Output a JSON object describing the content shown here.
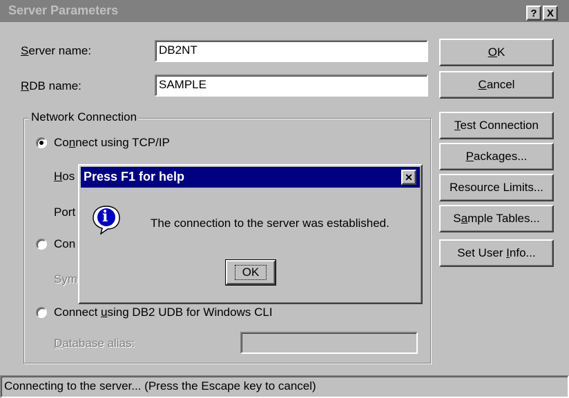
{
  "window": {
    "title": "Server Parameters",
    "help_glyph": "?",
    "close_glyph": "X",
    "title_bg": "#808080"
  },
  "form": {
    "server_name_label_u": "S",
    "server_name_label_rest": "erver name:",
    "server_name_value": "DB2NT",
    "rdb_name_label_u": "R",
    "rdb_name_label_rest": "DB name:",
    "rdb_name_value": "SAMPLE"
  },
  "network": {
    "group_label": "Network Connection",
    "tcp": {
      "pre": "Co",
      "u": "n",
      "post": "nect using TCP/IP",
      "checked": true
    },
    "host_label_u": "H",
    "host_label_rest": "os",
    "port_label": "Port",
    "conn_label": "Con",
    "sym_label": "Sym",
    "cli": {
      "pre": "Connect ",
      "u": "u",
      "post": "sing DB2 UDB for Windows CLI",
      "checked": false
    },
    "db_alias_u": "D",
    "db_alias_rest": "atabase alias:"
  },
  "buttons": {
    "ok_u": "O",
    "ok_rest": "K",
    "cancel_u": "C",
    "cancel_rest": "ancel",
    "test_u": "T",
    "test_rest": "est Connection",
    "packages_u": "P",
    "packages_rest": "ackages...",
    "resource_limits": "Resource Limits...",
    "sample_pre": "S",
    "sample_u": "a",
    "sample_rest": "mple Tables...",
    "user_pre": "Set User ",
    "user_u": "I",
    "user_rest": "nfo..."
  },
  "dialog": {
    "title": "Press F1 for help",
    "close_glyph": "✕",
    "message": "The connection to the server was established.",
    "ok_label": "OK",
    "icon_glyph": "i",
    "title_bg": "#000080"
  },
  "status": {
    "text": "Connecting to the server... (Press the Escape key to cancel)"
  }
}
